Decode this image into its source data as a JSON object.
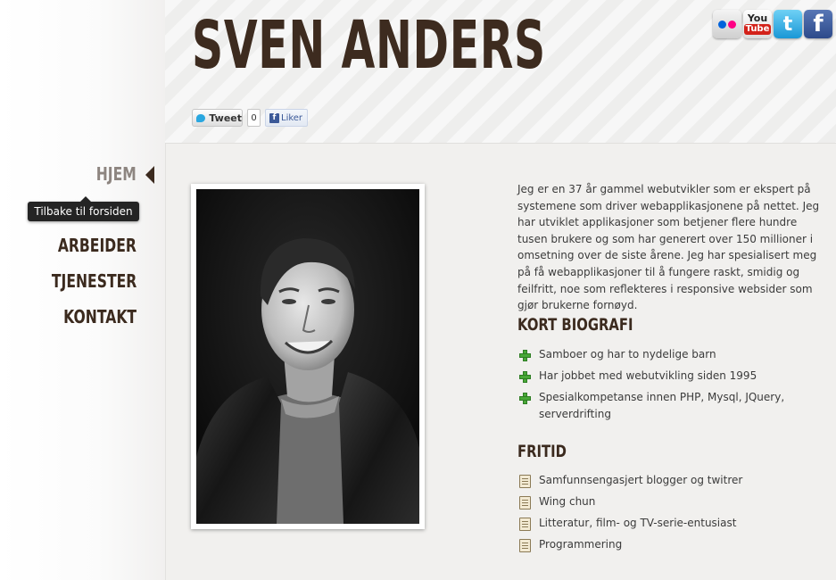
{
  "header": {
    "title": "SVEN ANDERS",
    "social": [
      {
        "name": "flickr"
      },
      {
        "name": "youtube",
        "label_top": "You",
        "label_bottom": "Tube"
      },
      {
        "name": "twitter",
        "label": "t"
      },
      {
        "name": "facebook",
        "label": "f"
      }
    ],
    "share": {
      "tweet_label": "Tweet",
      "tweet_count": "0",
      "like_icon": "f",
      "like_label": "Liker"
    }
  },
  "nav": {
    "items": [
      {
        "label": "HJEM",
        "active": true
      },
      {
        "label": "ARBEIDER"
      },
      {
        "label": "TJENESTER"
      },
      {
        "label": "KONTAKT"
      }
    ],
    "tooltip": "Tilbake til forsiden"
  },
  "main": {
    "intro": "Jeg er en 37 år gammel webutvikler som er ekspert på systemene som driver webapplikasjonene på nettet. Jeg har utviklet applikasjoner som betjener flere hundre tusen brukere og som har generert over 150 millioner i omsetning over de siste årene. Jeg har spesialisert meg på få webapplikasjoner til å fungere raskt, smidig og feilfritt, noe som reflekteres i responsive websider som gjør brukerne fornøyd.",
    "bio_title": "KORT BIOGRAFI",
    "bio_items": [
      "Samboer og har to nydelige barn",
      "Har jobbet med webutvikling siden 1995",
      "Spesialkompetanse innen PHP, Mysql, JQuery, serverdrifting"
    ],
    "free_title": "FRITID",
    "free_items": [
      "Samfunnsengasjert blogger og twitrer",
      "Wing chun",
      "Litteratur, film- og TV-serie-entusiast",
      "Programmering"
    ]
  },
  "colors": {
    "title": "#3d2b1f",
    "nav": "#3b2a1e",
    "nav_active": "#8d8580",
    "tooltip_bg": "#242424",
    "plus_icon": "#49a838"
  }
}
